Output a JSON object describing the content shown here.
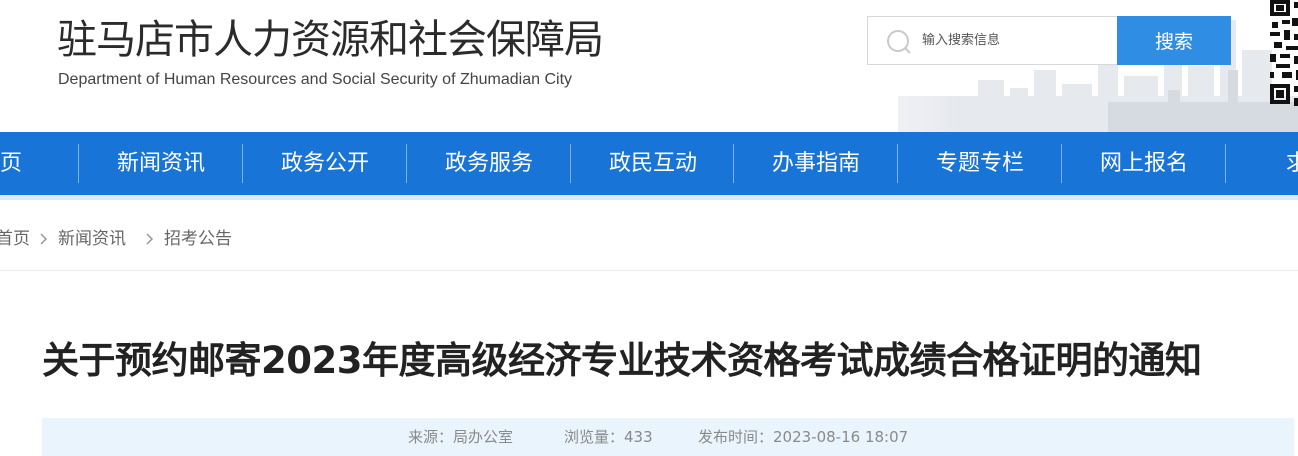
{
  "header": {
    "title": "驻马店市人力资源和社会保障局",
    "subtitle": "Department of Human Resources and Social Security of Zhumadian City",
    "search": {
      "placeholder": "输入搜索信息",
      "button_label": "搜索",
      "icon": "search-icon"
    },
    "qr_icon": "qr-code-icon"
  },
  "nav": {
    "items": [
      {
        "label": "首页"
      },
      {
        "label": "新闻资讯"
      },
      {
        "label": "政务公开"
      },
      {
        "label": "政务服务"
      },
      {
        "label": "政民互动"
      },
      {
        "label": "办事指南"
      },
      {
        "label": "专题专栏"
      },
      {
        "label": "网上报名"
      },
      {
        "label": "求职"
      }
    ]
  },
  "breadcrumb": {
    "items": [
      {
        "label": "首页"
      },
      {
        "label": "新闻资讯"
      },
      {
        "label": "招考公告"
      }
    ],
    "separator_icon": "chevron-right-icon"
  },
  "article": {
    "title": "关于预约邮寄2023年度高级经济专业技术资格考试成绩合格证明的通知",
    "meta": {
      "source": "来源：局办公室",
      "views": "浏览量：433",
      "published": "发布时间：2023-08-16 18:07"
    }
  },
  "colors": {
    "nav_background": "#1874d6",
    "search_button": "#2f8de4",
    "meta_background": "#eaf4fd"
  }
}
